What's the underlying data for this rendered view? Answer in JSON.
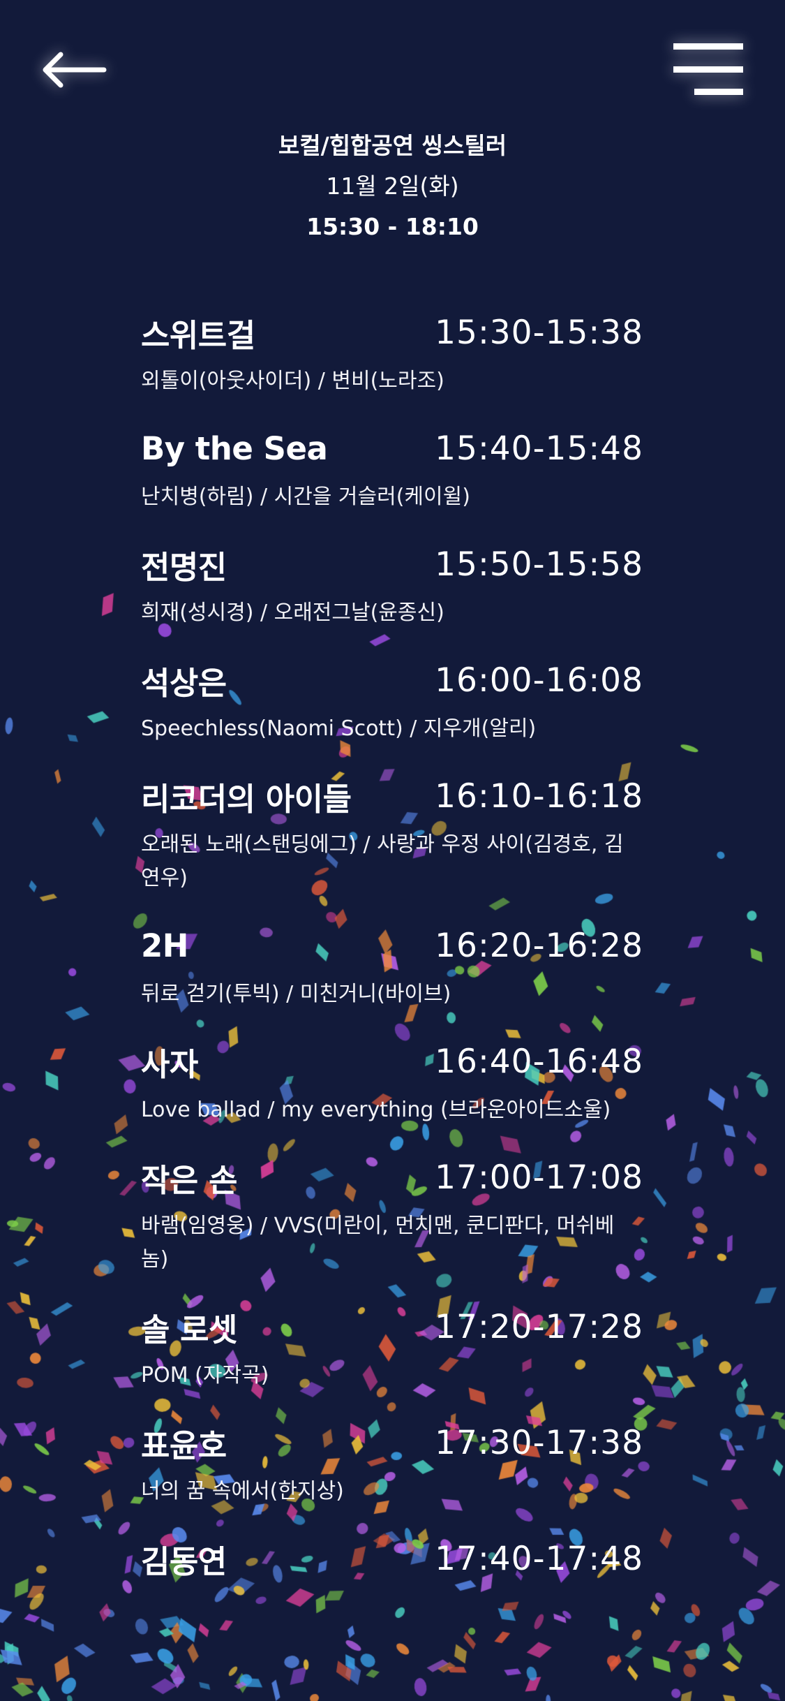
{
  "header": {
    "title": "보컬/힙합공연 씽스틸러",
    "date": "11월 2일(화)",
    "time_range": "15:30 - 18:10"
  },
  "icons": {
    "back": "arrow-left-icon",
    "menu": "hamburger-menu-icon"
  },
  "colors": {
    "background": "#121a3a",
    "text": "#ffffff"
  },
  "schedule": [
    {
      "name": "스위트걸",
      "time": "15:30-15:38",
      "songs": "외톨이(아웃사이더) / 변비(노라조)"
    },
    {
      "name": "By the Sea",
      "time": "15:40-15:48",
      "songs": "난치병(하림) / 시간을 거슬러(케이윌)"
    },
    {
      "name": "전명진",
      "time": "15:50-15:58",
      "songs": "희재(성시경) / 오래전그날(윤종신)"
    },
    {
      "name": "석상은",
      "time": "16:00-16:08",
      "songs": "Speechless(Naomi Scott) / 지우개(알리)"
    },
    {
      "name": "리코더의 아이들",
      "time": "16:10-16:18",
      "songs": "오래된 노래(스탠딩에그) / 사랑과 우정 사이(김경호, 김연우)"
    },
    {
      "name": "2H",
      "time": "16:20-16:28",
      "songs": "뒤로 걷기(투빅) / 미친거니(바이브)"
    },
    {
      "name": "사자",
      "time": "16:40-16:48",
      "songs": "Love ballad / my everything (브라운아이드소울)"
    },
    {
      "name": "작은 손",
      "time": "17:00-17:08",
      "songs": "바램(임영웅) / VVS(미란이, 먼치맨, 쿤디판다, 머쉬베놈)"
    },
    {
      "name": "솔 로셋",
      "time": "17:20-17:28",
      "songs": "POM (자작곡)"
    },
    {
      "name": "표윤호",
      "time": "17:30-17:38",
      "songs": "너의 꿈 속에서(한지상)"
    },
    {
      "name": "김동연",
      "time": "17:40-17:48",
      "songs": ""
    }
  ]
}
